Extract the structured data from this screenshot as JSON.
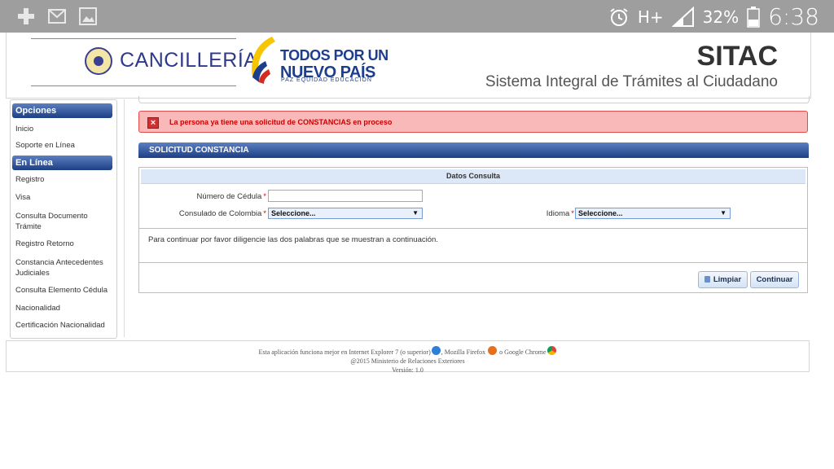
{
  "status_bar": {
    "icons_left": [
      "medical-cross-icon",
      "gmail-icon",
      "gallery-icon"
    ],
    "network": "H+",
    "battery": "32%",
    "time": "6:38"
  },
  "header": {
    "logo_text": "CANCILLERÍA",
    "slogan_line1": "TODOS POR UN",
    "slogan_line2": "NUEVO PAÍS",
    "slogan_line3": "PAZ  EQUIDAD  EDUCACIÓN",
    "app_name": "SITAC",
    "app_subtitle": "Sistema Integral de Trámites al Ciudadano"
  },
  "sidebar": {
    "sections": [
      {
        "title": "Opciones",
        "items": [
          "Inicio",
          "Soporte en Línea"
        ]
      },
      {
        "title": "En Línea",
        "items": [
          "Registro",
          "Visa",
          "Consulta Documento Trámite",
          "Registro Retorno",
          "Constancia Antecedentes Judiciales",
          "Consulta Elemento Cédula",
          "Nacionalidad",
          "Certificación Nacionalidad"
        ]
      }
    ]
  },
  "error_message": "La persona ya tiene una solicitud de CONSTANCIAS en proceso",
  "section_title": "SOLICITUD CONSTANCIA",
  "form": {
    "panel_title": "Datos Consulta",
    "cedula_label": "Número de Cédula",
    "cedula_value": "",
    "consulado_label": "Consulado de Colombia",
    "consulado_value": "Seleccione...",
    "idioma_label": "Idioma",
    "idioma_value": "Seleccione...",
    "required_mark": "*",
    "instruction": "Para continuar por favor diligencie las dos palabras que se muestran a continuación.",
    "clear_button": "Limpiar",
    "continue_button": "Continuar"
  },
  "footer": {
    "line1_a": "Esta aplicación funciona mejor en Internet Explorer 7 (o superior)",
    "line1_b": ", Mozilla Firefox",
    "line1_c": " o Google Chrome",
    "line2": "@2015 Ministerio de Relaciones Exteriores",
    "line3": "Versión: 1.0"
  }
}
